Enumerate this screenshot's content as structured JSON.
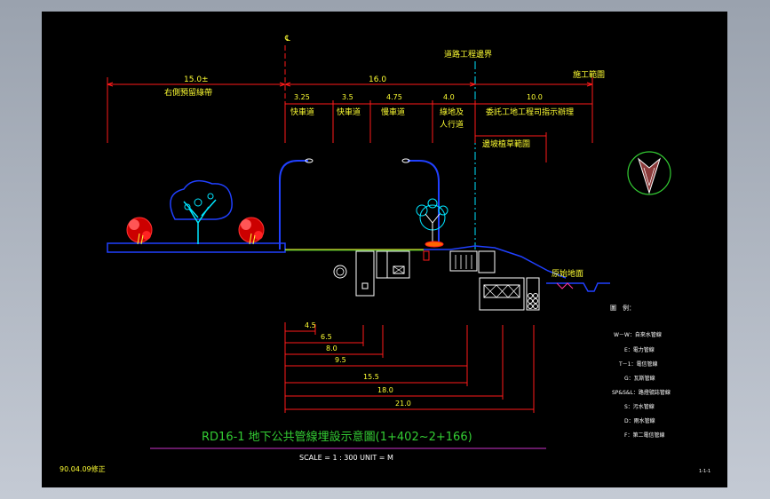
{
  "centerline_mark": "℄",
  "labels": {
    "road_boundary": "道路工程邊界",
    "construction_scope": "施工範圍",
    "existing_ground": "原始地面",
    "legend_title": "圖　例："
  },
  "top_dimensions": [
    {
      "value": "15.0±",
      "caption": "右側預留綠帶"
    },
    {
      "value": "16.0",
      "caption": ""
    },
    {
      "value": "10.0",
      "caption": "委託工地工程司指示辦理"
    }
  ],
  "lane_dimensions": [
    {
      "value": "3.25",
      "caption": "快車道"
    },
    {
      "value": "3.5",
      "caption": "快車道"
    },
    {
      "value": "4.75",
      "caption": "慢車道"
    },
    {
      "value": "4.0",
      "caption": "綠地及",
      "caption2": "人行道"
    }
  ],
  "slope_scope": "邊坡植草範圍",
  "bottom_dimensions": [
    "4.5",
    "6.5",
    "8.0",
    "9.5",
    "15.5",
    "18.0",
    "21.0"
  ],
  "legend": [
    "W－W：自來水管線",
    "E：電力管線",
    "T－1：電信管線",
    "G：瓦斯管線",
    "SP&S&L：路燈號誌管線",
    "S：污水管線",
    "D：雨水管線",
    "F：第二電信管線"
  ],
  "title": "RD16-1 地下公共管線埋設示意圖(1+402~2+166)",
  "scale_text": "SCALE = 1 : 300    UNIT = M",
  "revision": "90.04.09修正",
  "sheet_no": "1-1-1",
  "colors": {
    "dimension": "#ff1a1a",
    "text": "#ffff33",
    "title": "#33cc33",
    "cyan": "#00e5ff",
    "blue": "#2040ff",
    "white": "#ffffff",
    "magenta": "#cc33cc"
  }
}
